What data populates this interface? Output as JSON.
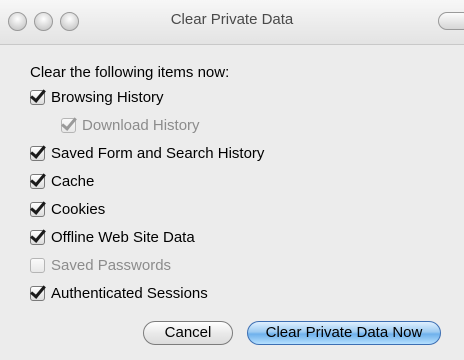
{
  "window": {
    "title": "Clear Private Data"
  },
  "content": {
    "heading": "Clear the following items now:",
    "items": [
      {
        "label": "Browsing History",
        "checked": true,
        "enabled": true,
        "indent": false
      },
      {
        "label": "Download History",
        "checked": true,
        "enabled": false,
        "indent": true
      },
      {
        "label": "Saved Form and Search History",
        "checked": true,
        "enabled": true,
        "indent": false
      },
      {
        "label": "Cache",
        "checked": true,
        "enabled": true,
        "indent": false
      },
      {
        "label": "Cookies",
        "checked": true,
        "enabled": true,
        "indent": false
      },
      {
        "label": "Offline Web Site Data",
        "checked": true,
        "enabled": true,
        "indent": false
      },
      {
        "label": "Saved Passwords",
        "checked": false,
        "enabled": false,
        "indent": false
      },
      {
        "label": "Authenticated Sessions",
        "checked": true,
        "enabled": true,
        "indent": false
      }
    ]
  },
  "buttons": {
    "cancel_label": "Cancel",
    "primary_label": "Clear Private Data Now"
  },
  "colors": {
    "primary_button": "#6fb1ec",
    "disabled_text": "#8c8c8c"
  }
}
